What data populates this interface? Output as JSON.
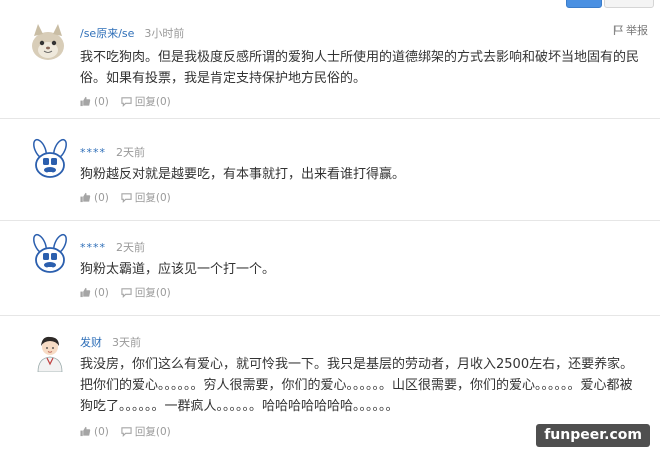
{
  "report_label": "举报",
  "comments": [
    {
      "username": "/se原来/se",
      "time": "3小时前",
      "text": "我不吃狗肉。但是我极度反感所谓的爱狗人士所使用的道德绑架的方式去影响和破坏当地固有的民俗。如果有投票，我是肯定支持保护地方民俗的。",
      "like": "(0)",
      "reply": "回复(0)"
    },
    {
      "username": "****",
      "time": "2天前",
      "text": "狗粉越反对就是越要吃，有本事就打，出来看谁打得赢。",
      "like": "(0)",
      "reply": "回复(0)"
    },
    {
      "username": "****",
      "time": "2天前",
      "text": "狗粉太霸道，应该见一个打一个。",
      "like": "(0)",
      "reply": "回复(0)"
    },
    {
      "username": "发财",
      "time": "3天前",
      "text": "我没房，你们这么有爱心，就可怜我一下。我只是基层的劳动者，月收入2500左右，还要养家。把你们的爱心。。。。。。穷人很需要，你们的爱心。。。。。。山区很需要，你们的爱心。。。。。。爱心都被狗吃了。。。。。。一群疯人。。。。。。哈哈哈哈哈哈哈。。。。。。",
      "like": "(0)",
      "reply": "回复(0)"
    }
  ],
  "watermark": "funpeer.com",
  "colors": {
    "username": "#2f6fb8",
    "time": "#999999",
    "text": "#333333",
    "actions": "#9a9a9a",
    "divider": "#e6e6e6"
  }
}
